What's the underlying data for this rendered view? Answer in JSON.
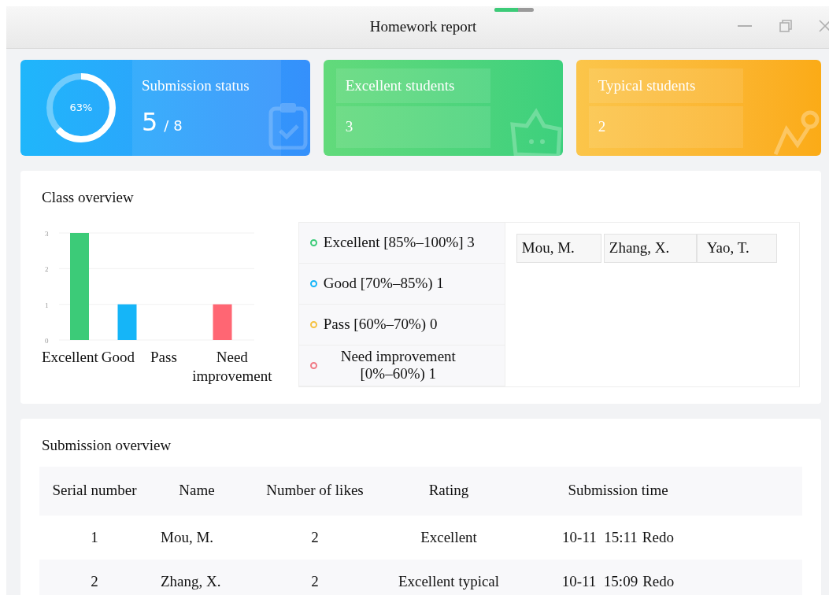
{
  "window": {
    "title": "Homework report"
  },
  "cards": [
    {
      "kind": "status",
      "title": "Submission status",
      "percent": "63%",
      "count": "5",
      "total": "/ 8"
    },
    {
      "kind": "stat",
      "title": "Excellent students",
      "value": "3"
    },
    {
      "kind": "stat",
      "title": "Typical students",
      "value": "2"
    }
  ],
  "class_overview": {
    "title": "Class overview",
    "chart_data": {
      "type": "bar",
      "series": [
        {
          "name": "Excellent",
          "color": "#3ccb78",
          "values": [
            3
          ]
        },
        {
          "name": "Good",
          "color": "#15b5f8",
          "values": [
            1
          ]
        },
        {
          "name": "Pass",
          "values": [
            0
          ]
        },
        {
          "name": "Need improvement",
          "color": "#ff6673",
          "values": [
            1
          ]
        }
      ],
      "ylim": [
        0,
        3
      ],
      "yticks": [
        0,
        1,
        2,
        3
      ]
    },
    "legend": [
      {
        "label": "Excellent [85%–100%] 3",
        "color": "#3ccb78"
      },
      {
        "label": "Good [70%–85%) 1",
        "color": "#15b5f8"
      },
      {
        "label": "Pass [60%–70%) 0",
        "color": "#f5c242"
      },
      {
        "label": "Need improvement [0%–60%) 1",
        "color": "#f07a85"
      }
    ],
    "students": [
      "Mou, M.",
      "Zhang, X.",
      "Yao, T."
    ]
  },
  "submission_overview": {
    "title": "Submission overview",
    "columns": [
      "Serial number",
      "Name",
      "Number of likes",
      "Rating",
      "Submission time"
    ],
    "rows": [
      {
        "serial": "1",
        "name": "Mou, M.",
        "likes": "2",
        "rating": "Excellent",
        "time": "10-11  15:11",
        "action": "Redo"
      },
      {
        "serial": "2",
        "name": "Zhang, X.",
        "likes": "2",
        "rating": "Excellent typical",
        "time": "10-11  15:09",
        "action": "Redo"
      }
    ]
  }
}
